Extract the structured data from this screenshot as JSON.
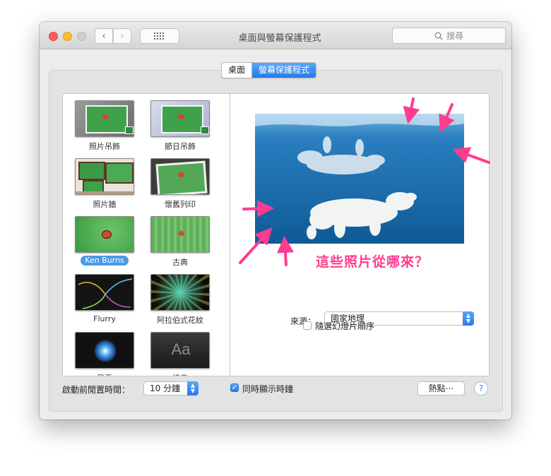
{
  "window": {
    "title": "桌面與螢幕保護程式",
    "search_placeholder": "搜尋"
  },
  "tabs": [
    {
      "label": "桌面",
      "selected": false
    },
    {
      "label": "螢幕保護程式",
      "selected": true
    }
  ],
  "savers": [
    {
      "label": "照片吊飾"
    },
    {
      "label": "節日吊飾"
    },
    {
      "label": "照片牆"
    },
    {
      "label": "懷舊列印"
    },
    {
      "label": "Ken Burns",
      "selected": true
    },
    {
      "label": "古典"
    },
    {
      "label": "Flurry"
    },
    {
      "label": "阿拉伯式花紋"
    },
    {
      "label": "星雲"
    },
    {
      "label": "訊息"
    }
  ],
  "preview": {
    "source_label": "來源：",
    "source_value": "國家地理",
    "shuffle_label": "隨選幻燈片順序",
    "shuffle_checked": false
  },
  "bottom": {
    "idle_label": "啟動前閒置時間：",
    "idle_value": "10 分鐘",
    "show_clock_label": "同時顯示時鐘",
    "show_clock_checked": true,
    "hot_corners_label": "熱點⋯",
    "help_label": "?"
  },
  "annotation": {
    "text": "這些照片從哪來？",
    "color": "#ff3c8f"
  },
  "colors": {
    "accent": "#2579ec",
    "selection": "#4a9ae6"
  }
}
